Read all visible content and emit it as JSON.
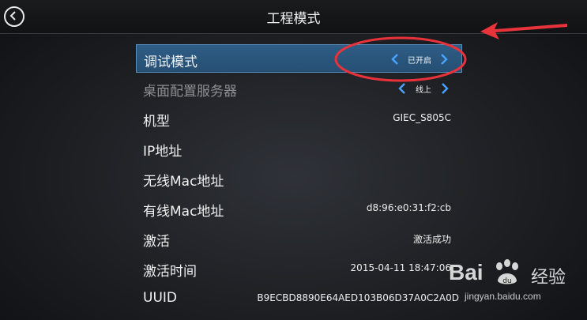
{
  "header": {
    "title": "工程模式",
    "back_icon": "back-circle-icon"
  },
  "rows": [
    {
      "label": "调试模式",
      "selector": "已开启"
    },
    {
      "label": "桌面配置服务器",
      "selector": "线上"
    },
    {
      "label": "机型",
      "value": "GIEC_S805C"
    },
    {
      "label": "IP地址",
      "value": ""
    },
    {
      "label": "无线Mac地址",
      "value": ""
    },
    {
      "label": "有线Mac地址",
      "value": "d8:96:e0:31:f2:cb"
    },
    {
      "label": "激活",
      "value": "激活成功"
    },
    {
      "label": "激活时间",
      "value": "2015-04-11 18:47:06"
    },
    {
      "label": "UUID",
      "value": "B9ECBD8890E64AED103B06D37A0C2A0D"
    }
  ],
  "watermark": {
    "brand": "Bai",
    "brand_suffix": "经验",
    "url": "jingyan.baidu.com"
  },
  "colors": {
    "highlight": "#2e5d86",
    "chevron": "#4aa3ff",
    "annotation_red": "#e8333a"
  }
}
